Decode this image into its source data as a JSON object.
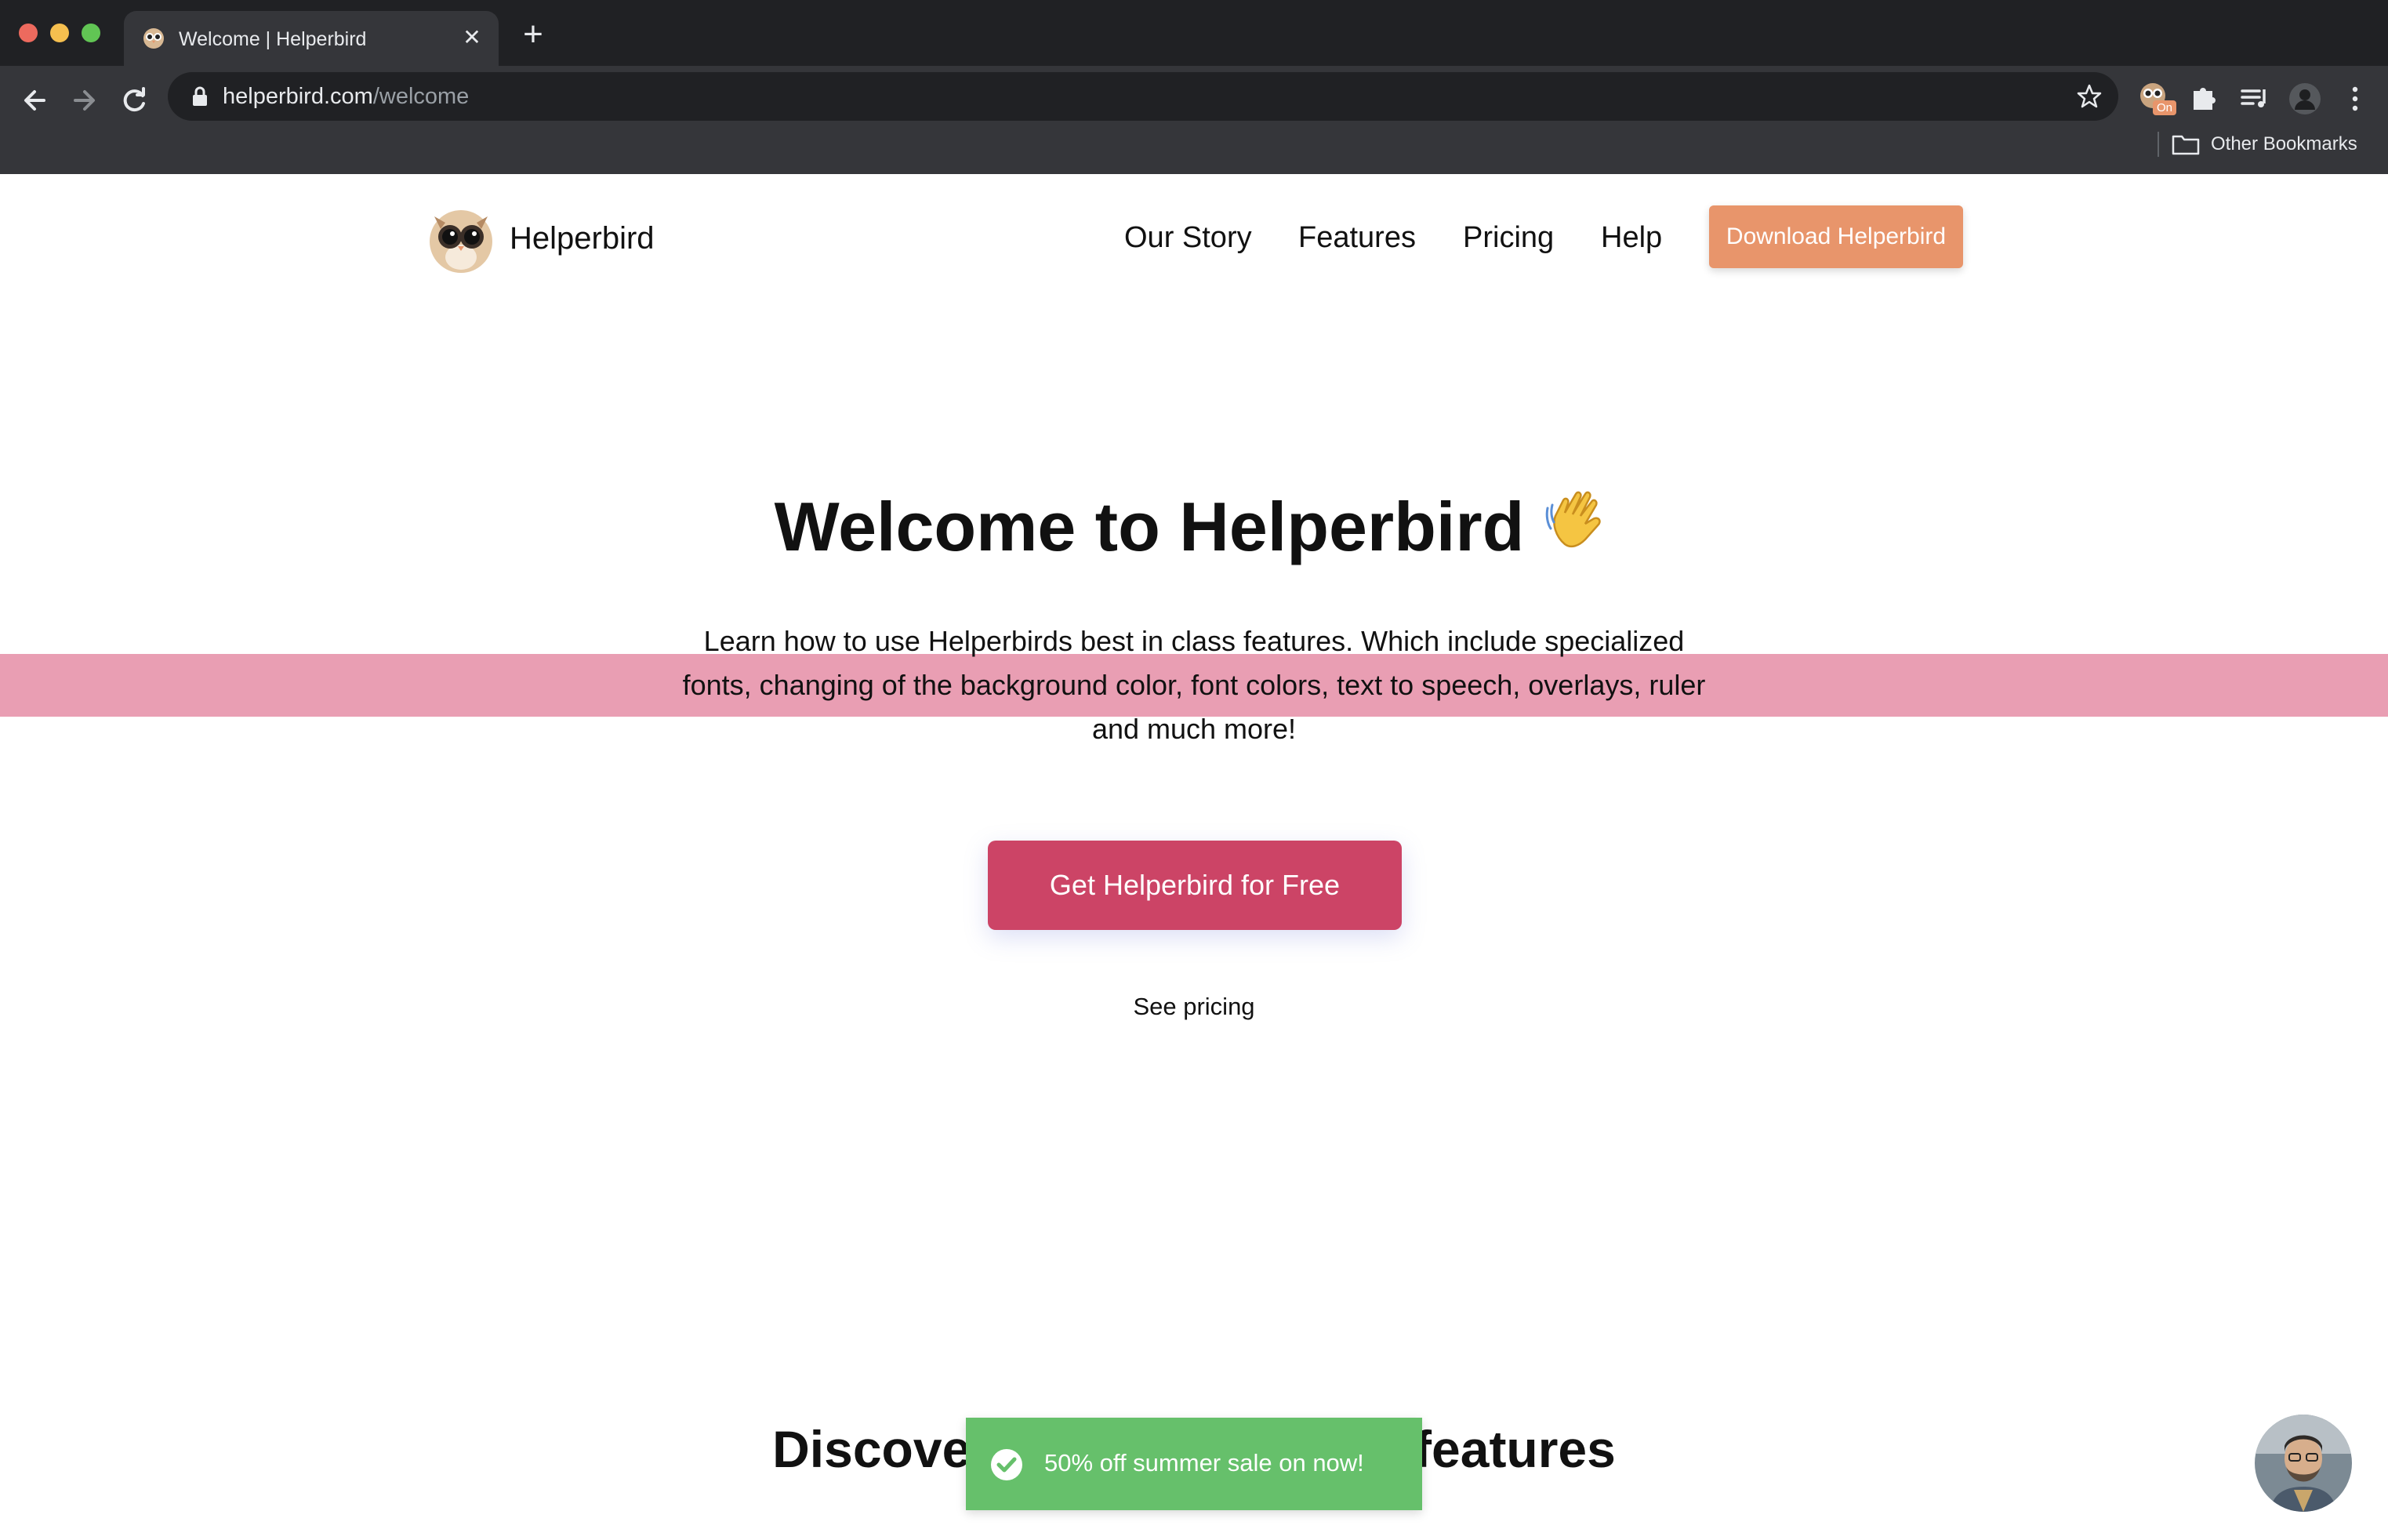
{
  "browser": {
    "tab_title": "Welcome | Helperbird",
    "url_host": "helperbird.com",
    "url_path": "/welcome",
    "extension_badge": "On",
    "bookmarks_label": "Other Bookmarks",
    "new_tab_label": "+",
    "close_tab_label": "✕"
  },
  "nav": {
    "brand": "Helperbird",
    "links": [
      "Our Story",
      "Features",
      "Pricing",
      "Help"
    ],
    "download_label": "Download Helperbird"
  },
  "hero": {
    "title": "Welcome to Helperbird",
    "description": "Learn how to use Helperbirds best in class features. Which include specialized fonts, changing of the background color, font colors, text to speech, overlays, ruler and much more!",
    "cta_label": "Get Helperbird for Free",
    "secondary_link": "See pricing"
  },
  "section": {
    "heading": "Discover Helperbird's top features"
  },
  "toast": {
    "message": "50% off summer sale on now!"
  },
  "colors": {
    "accent_orange": "#e8956b",
    "cta_red": "#cc4466",
    "ruler_pink": "#e890a8",
    "toast_green": "#66c06b",
    "chrome_dark": "#202124",
    "chrome_toolbar": "#35363a"
  }
}
